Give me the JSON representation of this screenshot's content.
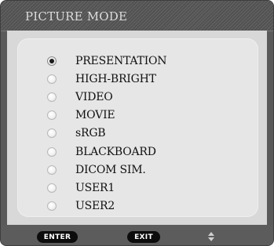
{
  "menu": {
    "title": "PICTURE MODE",
    "selected_index": 0,
    "options": [
      {
        "label": "PRESENTATION"
      },
      {
        "label": "HIGH-BRIGHT"
      },
      {
        "label": "VIDEO"
      },
      {
        "label": "MOVIE"
      },
      {
        "label": "sRGB"
      },
      {
        "label": "BLACKBOARD"
      },
      {
        "label": "DICOM SIM."
      },
      {
        "label": "USER1"
      },
      {
        "label": "USER2"
      }
    ]
  },
  "footer": {
    "enter_label": "ENTER",
    "exit_label": "EXIT",
    "navigate_icon": "up-down-arrows-icon"
  },
  "colors": {
    "frame": "#5a5a5a",
    "content_bg": "#d8d8d8",
    "panel_bg": "#e6e6e6",
    "pill_bg": "#0c0c0c",
    "text": "#111111"
  }
}
